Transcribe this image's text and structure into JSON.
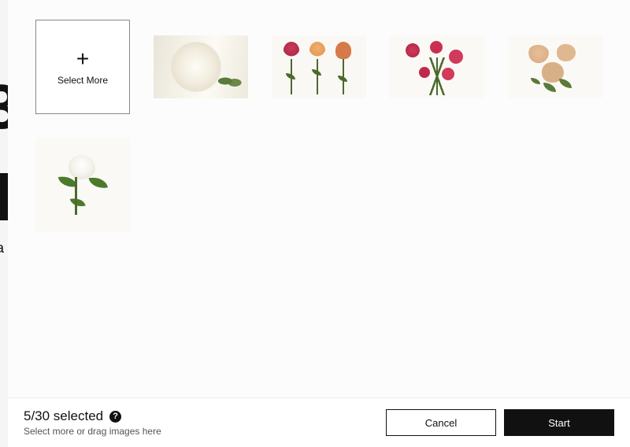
{
  "select_more": {
    "icon": "plus-icon",
    "label": "Select More"
  },
  "thumbnails": [
    {
      "alt": "white rose close-up"
    },
    {
      "alt": "three roses pink peach orange"
    },
    {
      "alt": "pink roses branch"
    },
    {
      "alt": "three peach roses"
    },
    {
      "alt": "single white rose with leaves"
    }
  ],
  "footer": {
    "count_text": "5/30 selected",
    "help_icon": "?",
    "hint": "Select more or drag images here",
    "cancel_label": "Cancel",
    "start_label": "Start"
  }
}
